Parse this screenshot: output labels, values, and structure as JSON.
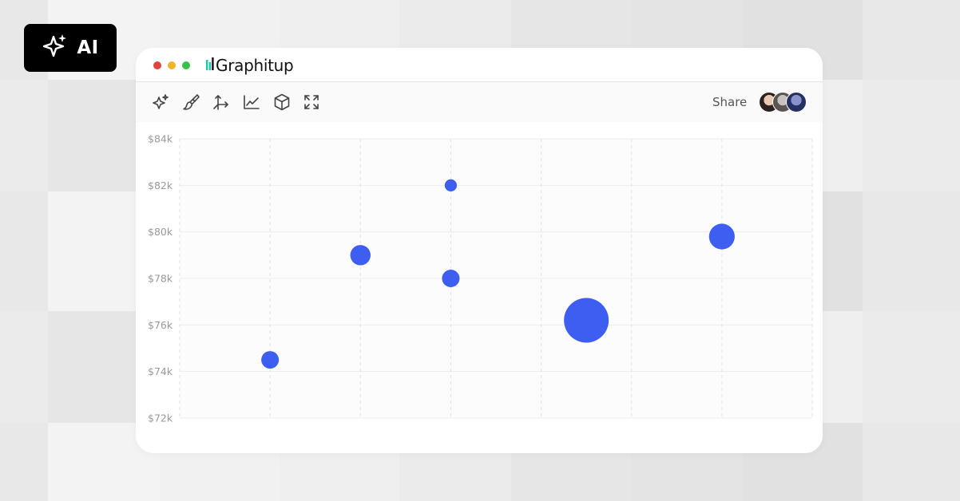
{
  "badge": {
    "label": "AI",
    "icon": "sparkles-icon"
  },
  "window": {
    "controls": {
      "close_color": "#e0443e",
      "minimize_color": "#f0b429",
      "maximize_color": "#37c14a"
    },
    "brand": {
      "name": "Graphitup",
      "logo_color": "#1cc9a6"
    }
  },
  "toolbar": {
    "tools": [
      "sparkles-icon",
      "brush-icon",
      "axes-icon",
      "line-chart-icon",
      "cube-icon",
      "expand-icon"
    ],
    "share_label": "Share",
    "collaborators": 3
  },
  "chart_data": {
    "type": "scatter",
    "title": "",
    "xlabel": "",
    "ylabel": "",
    "y_tick_labels": [
      "$84k",
      "$82k",
      "$80k",
      "$78k",
      "$76k",
      "$74k",
      "$72k"
    ],
    "ylim": [
      72000,
      84000
    ],
    "x_gridlines": 7,
    "grid": true,
    "marker_color": "#3d5ef0",
    "points": [
      {
        "x": 1,
        "y": 74500,
        "size": 1.0
      },
      {
        "x": 2,
        "y": 79000,
        "size": 1.1
      },
      {
        "x": 3,
        "y": 82000,
        "size": 0.8
      },
      {
        "x": 3,
        "y": 78000,
        "size": 1.0
      },
      {
        "x": 4.5,
        "y": 76200,
        "size": 2.0
      },
      {
        "x": 6,
        "y": 79800,
        "size": 1.3
      }
    ]
  }
}
